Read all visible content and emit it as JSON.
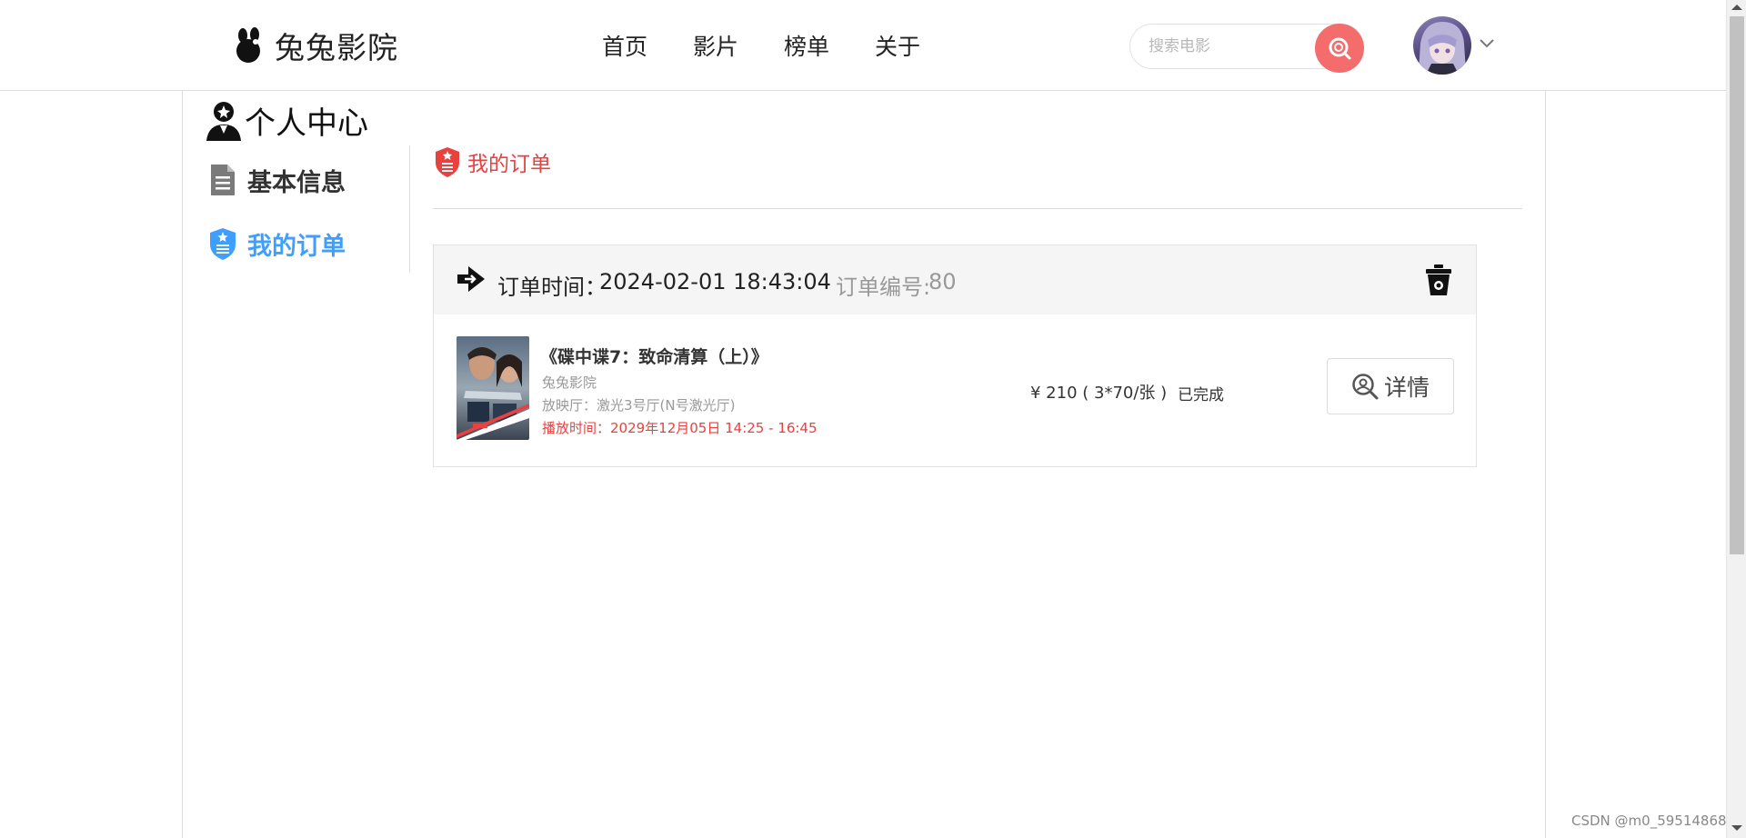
{
  "header": {
    "logo_text": "兔兔影院",
    "nav": [
      "首页",
      "影片",
      "榜单",
      "关于"
    ],
    "search_placeholder": "搜索电影"
  },
  "sidebar": {
    "title": "个人中心",
    "items": [
      {
        "label": "基本信息",
        "active": false
      },
      {
        "label": "我的订单",
        "active": true
      }
    ]
  },
  "main": {
    "section_title": "我的订单",
    "order": {
      "time_label": "订单时间：",
      "time_value": "2024-02-01 18:43:04",
      "number_label": "订单编号: ",
      "number_value": "80",
      "movie_title": "《碟中谍7：致命清算（上）》",
      "cinema": "兔兔影院",
      "hall": "放映厅：激光3号厅(N号激光厅)",
      "showtime": "播放时间：2029年12月05日 14:25 - 16:45",
      "price": "¥ 210 ( 3*70/张 )",
      "status": "已完成",
      "detail_label": "详情"
    }
  },
  "watermark": "CSDN @m0_59514868",
  "colors": {
    "accent_blue": "#409eff",
    "accent_red": "#e8423f",
    "search_button": "#f56c6c"
  }
}
